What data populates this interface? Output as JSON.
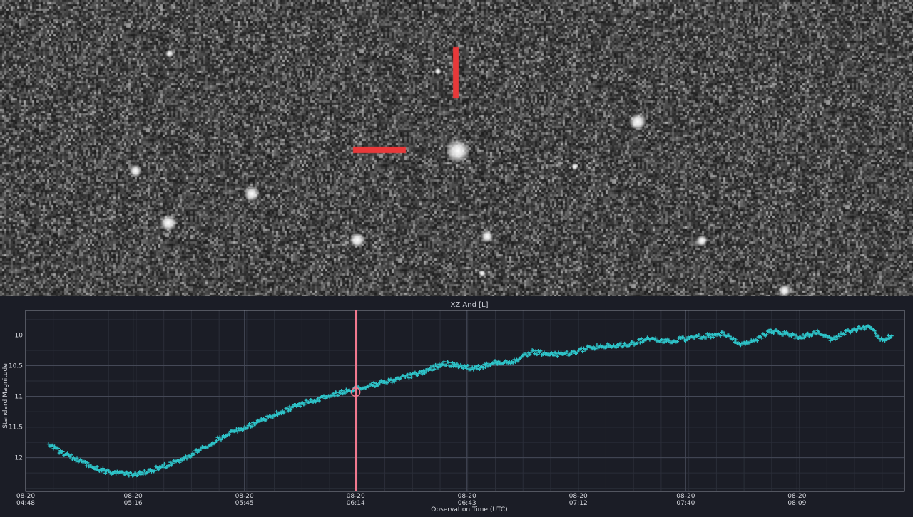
{
  "image_panel": {
    "type": "astronomical-star-field",
    "marker_color": "#e8393a",
    "target_marker": [
      "reticle-vertical-bar",
      "reticle-horizontal-bar"
    ]
  },
  "chart_data": {
    "type": "scatter",
    "title": "XZ And [L]",
    "xlabel": "Observation Time (UTC)",
    "ylabel": "Standard Magnitude",
    "y_inverted": true,
    "ylim": [
      12.55,
      9.6
    ],
    "yticks": [
      10,
      10.5,
      11,
      11.5,
      12
    ],
    "ytick_labels": [
      "10",
      "10.5",
      "11",
      "11.5",
      "12"
    ],
    "xlim": [
      "04:48",
      "08:37"
    ],
    "xticks": [
      "04:48",
      "05:16",
      "05:45",
      "06:14",
      "06:43",
      "07:12",
      "07:40",
      "08:09"
    ],
    "xtick_labels": [
      [
        "08-20",
        "04:48"
      ],
      [
        "08-20",
        "05:16"
      ],
      [
        "08-20",
        "05:45"
      ],
      [
        "08-20",
        "06:14"
      ],
      [
        "08-20",
        "06:43"
      ],
      [
        "08-20",
        "07:12"
      ],
      [
        "08-20",
        "07:40"
      ],
      [
        "08-20",
        "08:09"
      ]
    ],
    "grid": true,
    "series": [
      {
        "marker": "plus",
        "color": "#2ec4c9",
        "trend": [
          [
            "04:54",
            11.8
          ],
          [
            "04:58",
            11.93
          ],
          [
            "05:02",
            12.05
          ],
          [
            "05:06",
            12.17
          ],
          [
            "05:10",
            12.24
          ],
          [
            "05:14",
            12.27
          ],
          [
            "05:18",
            12.26
          ],
          [
            "05:22",
            12.18
          ],
          [
            "05:26",
            12.1
          ],
          [
            "05:30",
            12.0
          ],
          [
            "05:34",
            11.85
          ],
          [
            "05:38",
            11.7
          ],
          [
            "05:42",
            11.58
          ],
          [
            "05:46",
            11.48
          ],
          [
            "05:50",
            11.38
          ],
          [
            "05:54",
            11.27
          ],
          [
            "05:58",
            11.16
          ],
          [
            "06:02",
            11.08
          ],
          [
            "06:06",
            11.02
          ],
          [
            "06:10",
            10.94
          ],
          [
            "06:14",
            10.88
          ],
          [
            "06:20",
            10.79
          ],
          [
            "06:26",
            10.7
          ],
          [
            "06:32",
            10.6
          ],
          [
            "06:37",
            10.46
          ],
          [
            "06:42",
            10.51
          ],
          [
            "06:45",
            10.55
          ],
          [
            "06:50",
            10.45
          ],
          [
            "06:55",
            10.43
          ],
          [
            "07:00",
            10.27
          ],
          [
            "07:05",
            10.32
          ],
          [
            "07:10",
            10.3
          ],
          [
            "07:15",
            10.2
          ],
          [
            "07:20",
            10.17
          ],
          [
            "07:25",
            10.16
          ],
          [
            "07:30",
            10.05
          ],
          [
            "07:35",
            10.1
          ],
          [
            "07:40",
            10.06
          ],
          [
            "07:45",
            10.02
          ],
          [
            "07:50",
            9.98
          ],
          [
            "07:54",
            10.15
          ],
          [
            "07:58",
            10.1
          ],
          [
            "08:02",
            9.93
          ],
          [
            "08:06",
            9.98
          ],
          [
            "08:10",
            10.04
          ],
          [
            "08:14",
            9.95
          ],
          [
            "08:18",
            10.07
          ],
          [
            "08:22",
            9.95
          ],
          [
            "08:26",
            9.88
          ],
          [
            "08:28",
            9.87
          ],
          [
            "08:31",
            10.08
          ],
          [
            "08:34",
            10.01
          ]
        ]
      }
    ],
    "cursor": {
      "time": "06:14",
      "magnitude": 10.93,
      "color": "#f0788e"
    }
  }
}
